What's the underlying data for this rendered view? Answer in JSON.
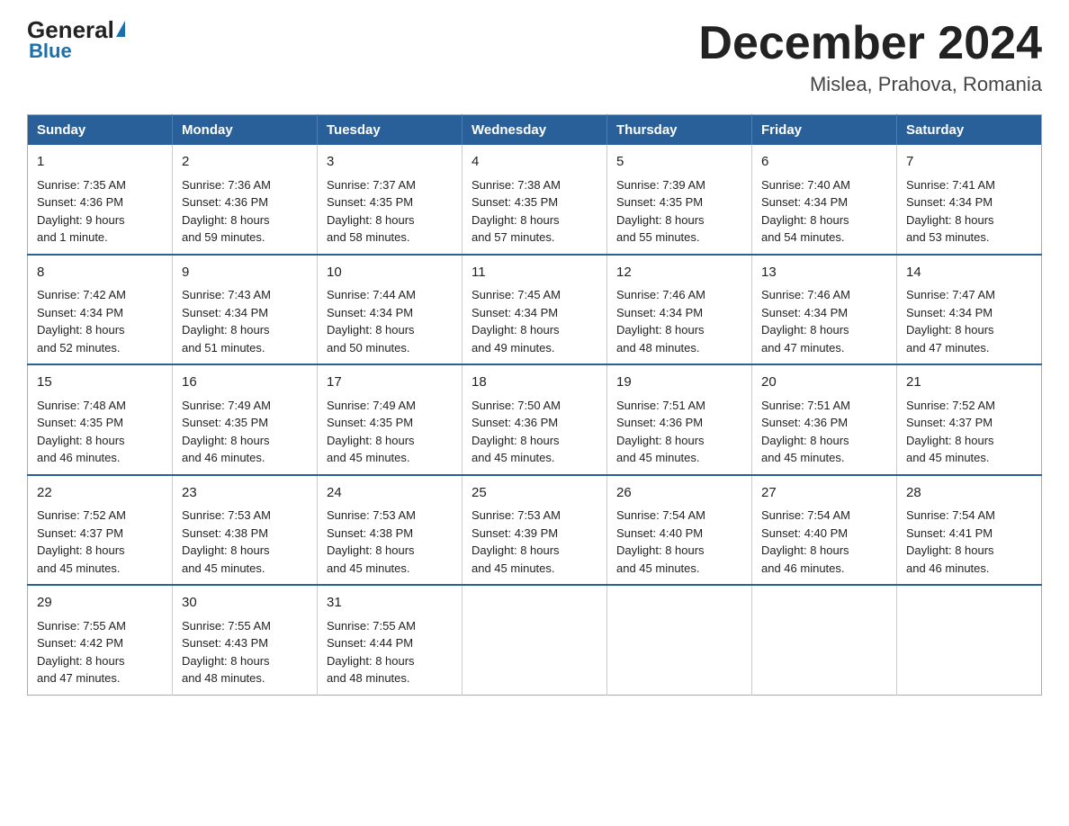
{
  "logo": {
    "general": "General",
    "triangle": "",
    "blue": "Blue"
  },
  "header": {
    "month_year": "December 2024",
    "location": "Mislea, Prahova, Romania"
  },
  "days_of_week": [
    "Sunday",
    "Monday",
    "Tuesday",
    "Wednesday",
    "Thursday",
    "Friday",
    "Saturday"
  ],
  "weeks": [
    [
      {
        "day": "1",
        "sunrise": "7:35 AM",
        "sunset": "4:36 PM",
        "daylight": "9 hours and 1 minute."
      },
      {
        "day": "2",
        "sunrise": "7:36 AM",
        "sunset": "4:36 PM",
        "daylight": "8 hours and 59 minutes."
      },
      {
        "day": "3",
        "sunrise": "7:37 AM",
        "sunset": "4:35 PM",
        "daylight": "8 hours and 58 minutes."
      },
      {
        "day": "4",
        "sunrise": "7:38 AM",
        "sunset": "4:35 PM",
        "daylight": "8 hours and 57 minutes."
      },
      {
        "day": "5",
        "sunrise": "7:39 AM",
        "sunset": "4:35 PM",
        "daylight": "8 hours and 55 minutes."
      },
      {
        "day": "6",
        "sunrise": "7:40 AM",
        "sunset": "4:34 PM",
        "daylight": "8 hours and 54 minutes."
      },
      {
        "day": "7",
        "sunrise": "7:41 AM",
        "sunset": "4:34 PM",
        "daylight": "8 hours and 53 minutes."
      }
    ],
    [
      {
        "day": "8",
        "sunrise": "7:42 AM",
        "sunset": "4:34 PM",
        "daylight": "8 hours and 52 minutes."
      },
      {
        "day": "9",
        "sunrise": "7:43 AM",
        "sunset": "4:34 PM",
        "daylight": "8 hours and 51 minutes."
      },
      {
        "day": "10",
        "sunrise": "7:44 AM",
        "sunset": "4:34 PM",
        "daylight": "8 hours and 50 minutes."
      },
      {
        "day": "11",
        "sunrise": "7:45 AM",
        "sunset": "4:34 PM",
        "daylight": "8 hours and 49 minutes."
      },
      {
        "day": "12",
        "sunrise": "7:46 AM",
        "sunset": "4:34 PM",
        "daylight": "8 hours and 48 minutes."
      },
      {
        "day": "13",
        "sunrise": "7:46 AM",
        "sunset": "4:34 PM",
        "daylight": "8 hours and 47 minutes."
      },
      {
        "day": "14",
        "sunrise": "7:47 AM",
        "sunset": "4:34 PM",
        "daylight": "8 hours and 47 minutes."
      }
    ],
    [
      {
        "day": "15",
        "sunrise": "7:48 AM",
        "sunset": "4:35 PM",
        "daylight": "8 hours and 46 minutes."
      },
      {
        "day": "16",
        "sunrise": "7:49 AM",
        "sunset": "4:35 PM",
        "daylight": "8 hours and 46 minutes."
      },
      {
        "day": "17",
        "sunrise": "7:49 AM",
        "sunset": "4:35 PM",
        "daylight": "8 hours and 45 minutes."
      },
      {
        "day": "18",
        "sunrise": "7:50 AM",
        "sunset": "4:36 PM",
        "daylight": "8 hours and 45 minutes."
      },
      {
        "day": "19",
        "sunrise": "7:51 AM",
        "sunset": "4:36 PM",
        "daylight": "8 hours and 45 minutes."
      },
      {
        "day": "20",
        "sunrise": "7:51 AM",
        "sunset": "4:36 PM",
        "daylight": "8 hours and 45 minutes."
      },
      {
        "day": "21",
        "sunrise": "7:52 AM",
        "sunset": "4:37 PM",
        "daylight": "8 hours and 45 minutes."
      }
    ],
    [
      {
        "day": "22",
        "sunrise": "7:52 AM",
        "sunset": "4:37 PM",
        "daylight": "8 hours and 45 minutes."
      },
      {
        "day": "23",
        "sunrise": "7:53 AM",
        "sunset": "4:38 PM",
        "daylight": "8 hours and 45 minutes."
      },
      {
        "day": "24",
        "sunrise": "7:53 AM",
        "sunset": "4:38 PM",
        "daylight": "8 hours and 45 minutes."
      },
      {
        "day": "25",
        "sunrise": "7:53 AM",
        "sunset": "4:39 PM",
        "daylight": "8 hours and 45 minutes."
      },
      {
        "day": "26",
        "sunrise": "7:54 AM",
        "sunset": "4:40 PM",
        "daylight": "8 hours and 45 minutes."
      },
      {
        "day": "27",
        "sunrise": "7:54 AM",
        "sunset": "4:40 PM",
        "daylight": "8 hours and 46 minutes."
      },
      {
        "day": "28",
        "sunrise": "7:54 AM",
        "sunset": "4:41 PM",
        "daylight": "8 hours and 46 minutes."
      }
    ],
    [
      {
        "day": "29",
        "sunrise": "7:55 AM",
        "sunset": "4:42 PM",
        "daylight": "8 hours and 47 minutes."
      },
      {
        "day": "30",
        "sunrise": "7:55 AM",
        "sunset": "4:43 PM",
        "daylight": "8 hours and 48 minutes."
      },
      {
        "day": "31",
        "sunrise": "7:55 AM",
        "sunset": "4:44 PM",
        "daylight": "8 hours and 48 minutes."
      },
      null,
      null,
      null,
      null
    ]
  ],
  "labels": {
    "sunrise": "Sunrise:",
    "sunset": "Sunset:",
    "daylight": "Daylight:"
  }
}
